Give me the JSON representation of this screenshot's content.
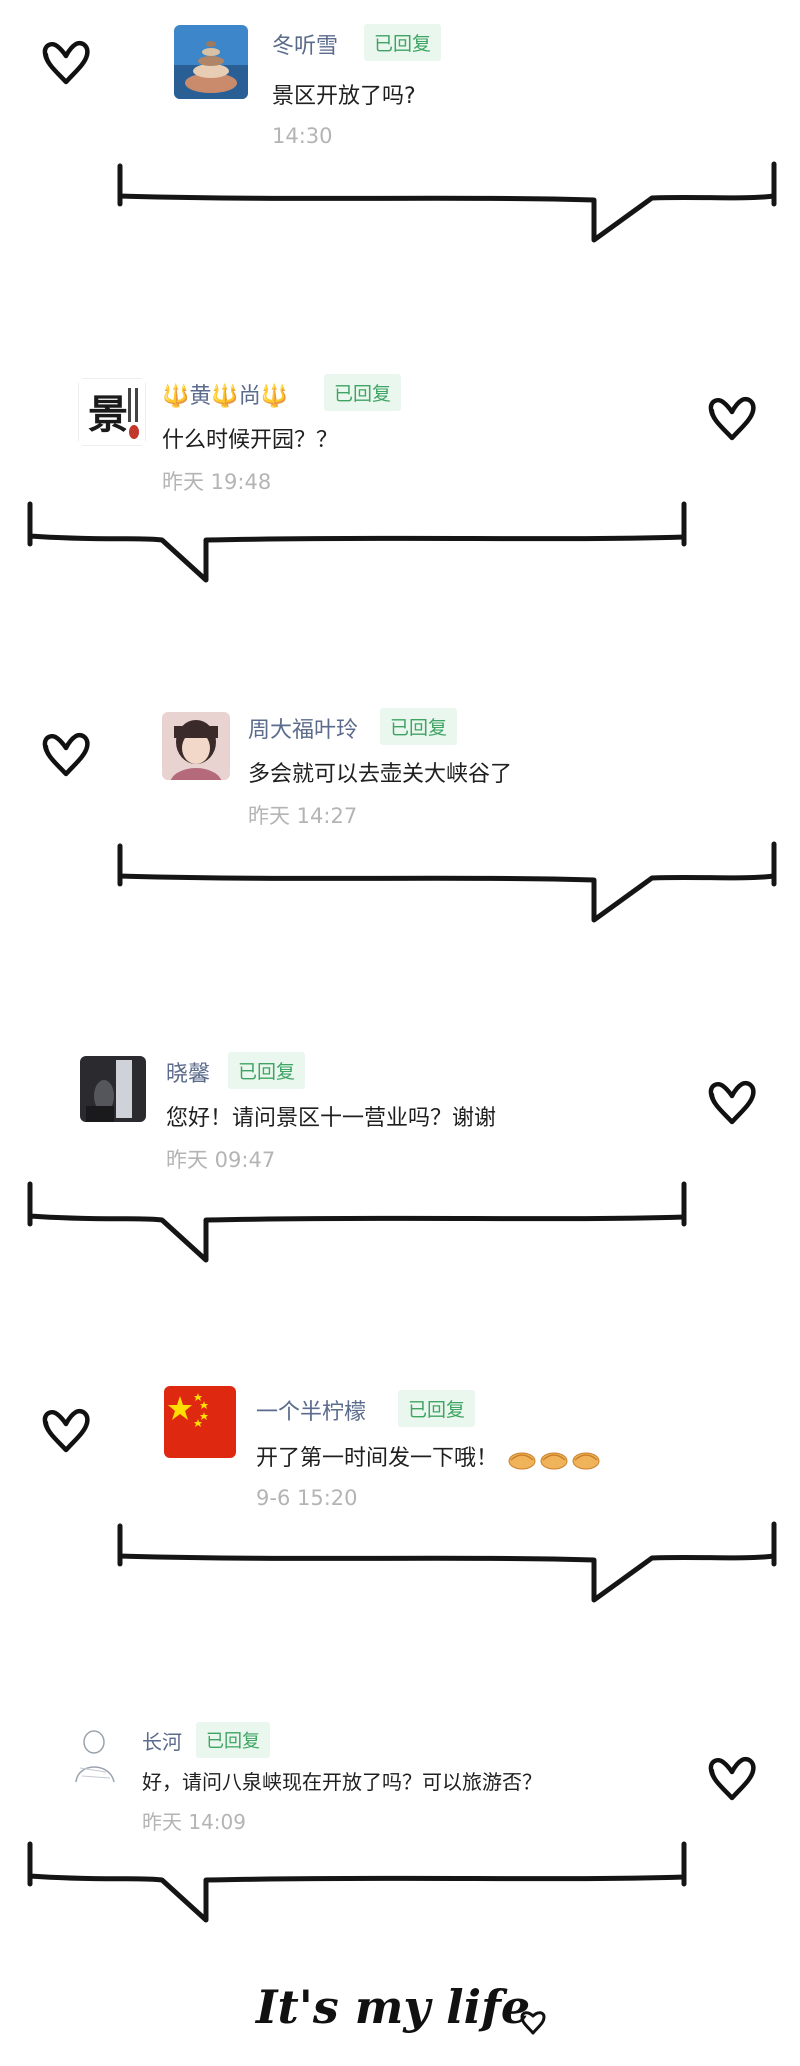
{
  "comments": [
    {
      "username": "冬听雪",
      "badge": "已回复",
      "message": "景区开放了吗?",
      "time": "14:30",
      "avatar": "stone-cairn-photo",
      "heart_side": "left"
    },
    {
      "username": "🔱黄🔱尚🔱",
      "badge": "已回复",
      "message": "什么时候开园？？",
      "time": "昨天 19:48",
      "avatar": "calligraphy-jing-logo",
      "heart_side": "right"
    },
    {
      "username": "周大福叶玲",
      "badge": "已回复",
      "message": "多会就可以去壶关大峡谷了",
      "time": "昨天 14:27",
      "avatar": "woman-portrait-photo",
      "heart_side": "left"
    },
    {
      "username": "晓馨",
      "badge": "已回复",
      "message": "您好！请问景区十一营业吗？谢谢",
      "time": "昨天 09:47",
      "avatar": "dark-room-photo",
      "heart_side": "right"
    },
    {
      "username": "一个半柠檬",
      "badge": "已回复",
      "message": "开了第一时间发一下哦！",
      "time": "9-6 15:20",
      "avatar": "china-flag",
      "heart_side": "left"
    },
    {
      "username": "长河",
      "badge": "已回复",
      "message": "好，请问八泉峡现在开放了吗？可以旅游否？",
      "time": "昨天 14:09",
      "avatar": "sketch-person-drawing",
      "heart_side": "right"
    }
  ],
  "footer": {
    "text": "It's my life",
    "icon": "heart-icon"
  },
  "colors": {
    "username": "#5b6b8c",
    "badge_bg": "#eaf7ee",
    "badge_text": "#3fa463",
    "time": "#b4b4b4",
    "ink": "#1a1a1a"
  }
}
